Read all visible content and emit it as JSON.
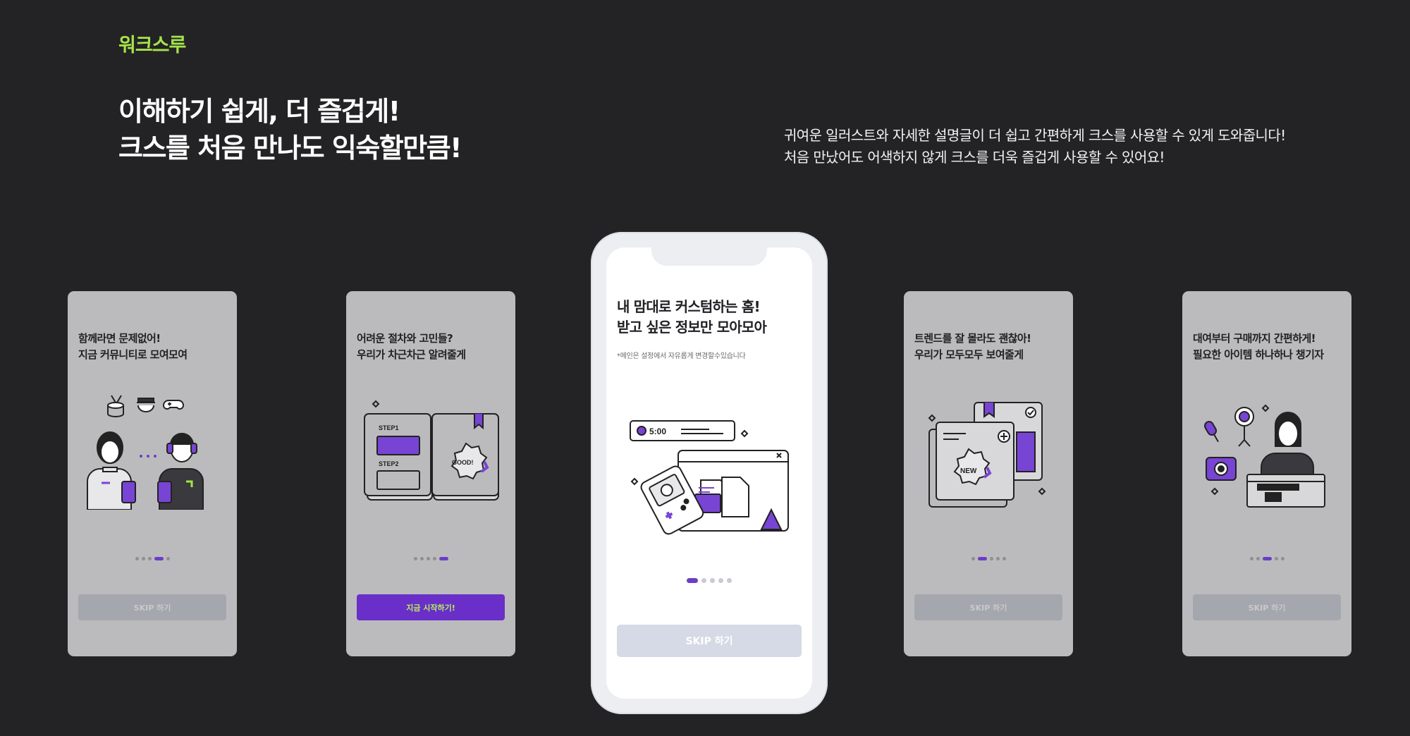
{
  "brand": "워크스루",
  "headline": {
    "line1": "이해하기 쉽게, 더 즐겁게!",
    "line2": "크스를 처음 만나도 익숙할만큼!"
  },
  "description": {
    "line1": "귀여운 일러스트와 자세한 설명글이 더 쉽고 간편하게 크스를 사용할 수 있게 도와줍니다!",
    "line2": "처음 만났어도 어색하지 않게 크스를 더욱 즐겁게 사용할 수 있어요!"
  },
  "colors": {
    "background": "#232326",
    "brand": "#a6e34a",
    "accent": "#6a2fc8",
    "card": "#bbbbbd"
  },
  "cards": [
    {
      "line1": "함께라면 문제없어!",
      "line2": "지금 커뮤니티로 모여모여",
      "button": "SKIP 하기",
      "active_dot": 4
    },
    {
      "line1": "어려운 절차와 고민들?",
      "line2": "우리가 차근차근 알려줄게",
      "button": "지금 시작하기!",
      "active_dot": 5
    },
    {
      "line1": "트렌드를 잘 몰라도 괜찮아!",
      "line2": "우리가 모두모두 보여줄게",
      "button": "SKIP 하기",
      "active_dot": 2
    },
    {
      "line1": "대여부터 구매까지 간편하게!",
      "line2": "필요한 아이템 하나하나 챙기자",
      "button": "SKIP 하기",
      "active_dot": 3
    }
  ],
  "phone": {
    "line1": "내 맘대로 커스텀하는 홈!",
    "line2": "받고 싶은 정보만 모아모아",
    "note": "*메인은 설정에서 자유롭게 변경할수있습니다",
    "timer": "5:00",
    "button": "SKIP 하기",
    "active_dot": 1
  },
  "badges": {
    "step1": "STEP1",
    "step2": "STEP2",
    "good": "GOOD!",
    "new": "NEW"
  }
}
